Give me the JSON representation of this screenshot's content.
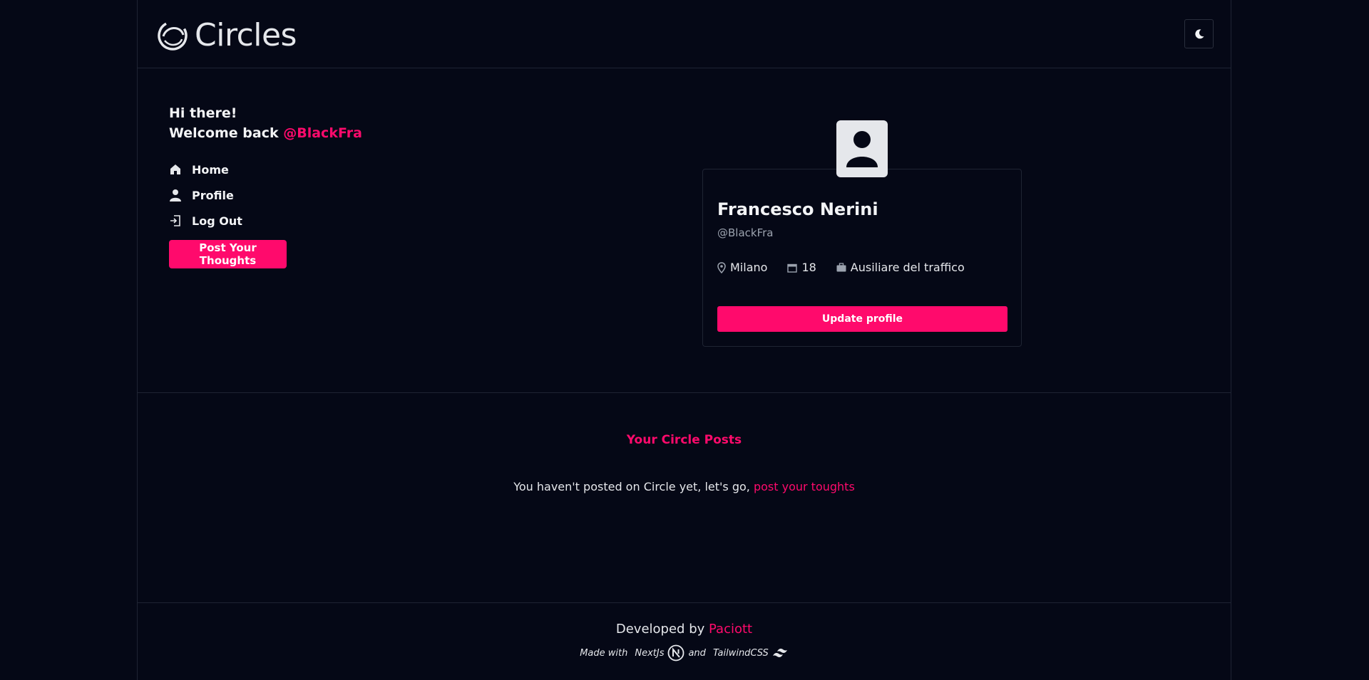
{
  "header": {
    "app_name": "Circles"
  },
  "sidebar": {
    "greeting_line1": "Hi there!",
    "greeting_prefix": "Welcome back ",
    "greeting_handle": "@BlackFra",
    "nav": [
      {
        "label": "Home",
        "icon": "home-icon"
      },
      {
        "label": "Profile",
        "icon": "user-icon"
      },
      {
        "label": "Log Out",
        "icon": "logout-icon"
      }
    ],
    "post_button": "Post Your Thoughts"
  },
  "profile": {
    "name": "Francesco Nerini",
    "handle": "@BlackFra",
    "location": "Milano",
    "age": "18",
    "job": "Ausiliare del traffico",
    "update_button": "Update profile"
  },
  "posts": {
    "title": "Your Circle Posts",
    "empty_text": "You haven't posted on Circle yet, let's go, ",
    "empty_link": "post your toughts"
  },
  "footer": {
    "developed_by": "Developed by ",
    "developer": "Paciott",
    "made_with": "Made with",
    "tech1": "NextJs",
    "and": "and",
    "tech2": "TailwindCSS"
  },
  "colors": {
    "background": "#050816",
    "accent": "#ff0a6c",
    "text": "#e5e7eb",
    "muted": "#9ca3af",
    "border": "#1f2433"
  }
}
